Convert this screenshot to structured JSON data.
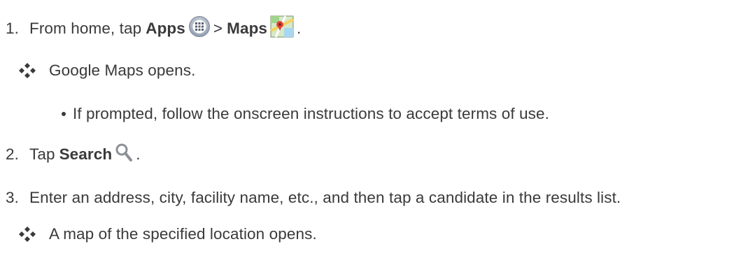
{
  "steps": [
    {
      "number": "1.",
      "text_before": "From home, tap ",
      "bold1": "Apps",
      "icon1": "apps-icon",
      "separator": " > ",
      "bold2": "Maps",
      "icon2": "maps-icon",
      "end": "."
    },
    {
      "number": "2.",
      "text_before": "Tap ",
      "bold1": "Search",
      "icon1": "search-icon",
      "end": "."
    },
    {
      "number": "3.",
      "text": "Enter an address, city, facility name, etc., and then tap a candidate in the results list."
    }
  ],
  "results": [
    {
      "icon": "diamond-bullet-icon",
      "text": "Google Maps opens."
    },
    {
      "icon": "diamond-bullet-icon",
      "text": "A map of the specified location opens."
    }
  ],
  "sub_bullet": {
    "icon": "dot-bullet-icon",
    "text": "If prompted, follow the onscreen instructions to accept terms of use."
  }
}
